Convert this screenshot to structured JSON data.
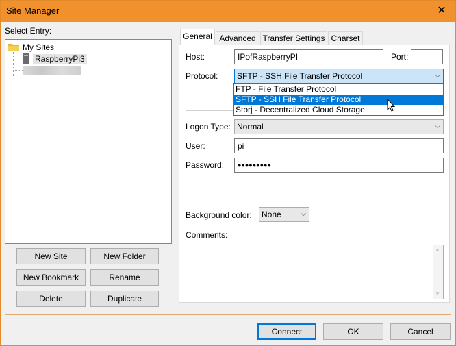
{
  "window": {
    "title": "Site Manager",
    "close_glyph": "✕"
  },
  "left": {
    "select_entry_label": "Select Entry:",
    "tree": {
      "folder": "My Sites",
      "site": "RaspberryPi3"
    },
    "buttons": {
      "new_site": "New Site",
      "new_folder": "New Folder",
      "new_bookmark": "New Bookmark",
      "rename": "Rename",
      "delete": "Delete",
      "duplicate": "Duplicate"
    }
  },
  "tabs": [
    "General",
    "Advanced",
    "Transfer Settings",
    "Charset"
  ],
  "general": {
    "host_label": "Host:",
    "host_value": "IPofRaspberryPI",
    "port_label": "Port:",
    "port_value": "",
    "protocol_label": "Protocol:",
    "protocol_value": "SFTP - SSH File Transfer Protocol",
    "protocol_options": [
      "FTP - File Transfer Protocol",
      "SFTP - SSH File Transfer Protocol",
      "Storj - Decentralized Cloud Storage"
    ],
    "logon_type_label": "Logon Type:",
    "logon_type_value": "Normal",
    "user_label": "User:",
    "user_value": "pi",
    "password_label": "Password:",
    "password_value": "●●●●●●●●●",
    "bg_color_label": "Background color:",
    "bg_color_value": "None",
    "comments_label": "Comments:"
  },
  "footer": {
    "connect": "Connect",
    "ok": "OK",
    "cancel": "Cancel"
  },
  "colors": {
    "titlebar": "#f0912e",
    "selection": "#0078d7",
    "border_accent": "#e38b2b"
  }
}
